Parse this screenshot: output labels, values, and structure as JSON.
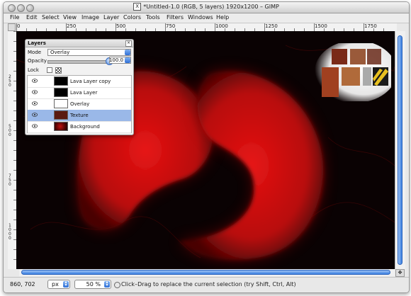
{
  "window": {
    "title": "*Untitled-1.0 (RGB, 5 layers) 1920x1200 – GIMP"
  },
  "menubar": {
    "items": [
      {
        "label": "File"
      },
      {
        "label": "Edit"
      },
      {
        "label": "Select"
      },
      {
        "label": "View"
      },
      {
        "label": "Image"
      },
      {
        "label": "Layer"
      },
      {
        "label": "Colors"
      },
      {
        "label": "Tools"
      },
      {
        "label": "Filters"
      },
      {
        "label": "Windows"
      },
      {
        "label": "Help"
      }
    ]
  },
  "rulers": {
    "horizontal_labels": [
      "0",
      "250",
      "500",
      "750",
      "1000",
      "1250",
      "1500",
      "1750"
    ],
    "vertical_labels": [
      "250",
      "500",
      "750",
      "1000"
    ]
  },
  "layers_panel": {
    "title": "Layers",
    "mode_label": "Mode",
    "mode_value": "Overlay",
    "opacity_label": "Opacity",
    "opacity_value": "100.0",
    "opacity_level": 1.0,
    "lock_label": "Lock",
    "layers": [
      {
        "name": "Lava Layer copy",
        "visible": true,
        "selected": false,
        "thumb_color": "#000000"
      },
      {
        "name": "Lava Layer",
        "visible": true,
        "selected": false,
        "thumb_color": "#000000"
      },
      {
        "name": "Overlay",
        "visible": true,
        "selected": false,
        "thumb_color": "#ffffff"
      },
      {
        "name": "Texture",
        "visible": true,
        "selected": true,
        "thumb_color": "#5a1a10"
      },
      {
        "name": "Background",
        "visible": true,
        "selected": false,
        "thumb_color": "#2a0000"
      }
    ]
  },
  "statusbar": {
    "coords": "860, 702",
    "unit": "px",
    "zoom": "50 %",
    "message": "Click–Drag to replace the current selection (try Shift, Ctrl, Alt)"
  },
  "colors": {
    "canvas_bg": "#0a0203",
    "lava_red": "#d01010",
    "selection_blue": "#9ab8e8",
    "scroll_blue": "#3b7fe0"
  }
}
